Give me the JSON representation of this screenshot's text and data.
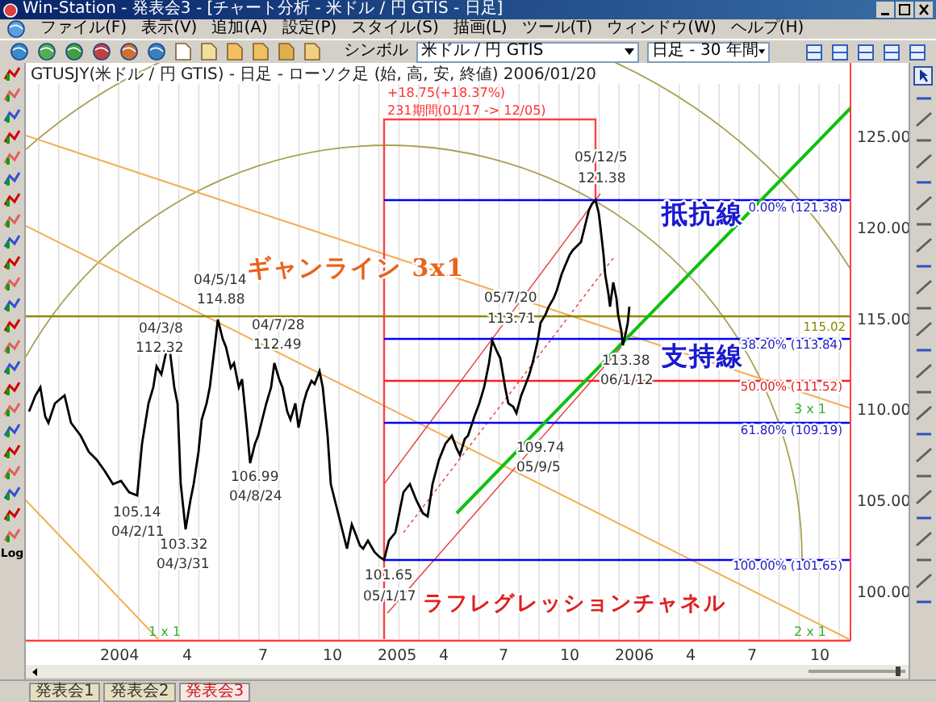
{
  "window": {
    "title": "Win-Station - 発表会3 - [チャート分析 - 米ドル / 円 GTIS - 日足]"
  },
  "menu": [
    "ファイル(F)",
    "表示(V)",
    "追加(A)",
    "設定(P)",
    "スタイル(S)",
    "描画(L)",
    "ツール(T)",
    "ウィンドウ(W)",
    "ヘルプ(H)"
  ],
  "toolbar": {
    "symbol_label": "シンボル",
    "symbol": "米ドル / 円 GTIS",
    "period": "日足 - 30 年間"
  },
  "left_toolbar": {
    "log_label": "Log"
  },
  "chart": {
    "header": "GTUSJY(米ドル / 円 GTIS) - 日足 - ローソク足 (始, 高, 安, 終値)  2006/01/20",
    "range_info": [
      "+18.75(+18.37%)",
      "231期間(01/17 -> 12/05)"
    ],
    "y_labels": [
      "125.00",
      "120.00",
      "115.00",
      "110.00",
      "105.00",
      "100.00"
    ],
    "x_labels": [
      "2004",
      "4",
      "7",
      "10",
      "2005",
      "4",
      "7",
      "10",
      "2006",
      "4",
      "7",
      "10"
    ],
    "annotations": [
      {
        "date": "04/5/14",
        "price": "114.88"
      },
      {
        "date": "04/3/8",
        "price": "112.32"
      },
      {
        "date": "04/7/28",
        "price": "112.49"
      },
      {
        "price": "105.14",
        "date": "04/2/11"
      },
      {
        "price": "103.32",
        "date": "04/3/31"
      },
      {
        "price": "106.99",
        "date": "04/8/24"
      },
      {
        "price": "101.65",
        "date": "05/1/17"
      },
      {
        "date": "05/7/20",
        "price": "113.71"
      },
      {
        "date": "05/12/5",
        "price": "121.38"
      },
      {
        "price": "113.38",
        "date": "06/1/12"
      },
      {
        "price": "109.74",
        "date": "05/9/5"
      }
    ],
    "fib_labels": [
      "0.00% (121.38)",
      "38.20% (113.84)",
      "50.00% (111.52)",
      "61.80% (109.19)",
      "100.00% (101.65)"
    ],
    "level_label": "115.02",
    "gann_labels": [
      "3 x 1",
      "2 x 1",
      "1 x 1"
    ],
    "titles": [
      "ギャンライン 3x1",
      "抵抗線",
      "支持線",
      "ラフレグレッションチャネル"
    ]
  },
  "zoom_slider": {
    "level": 0.95
  },
  "tabs": [
    {
      "label": "発表会1",
      "selected": false
    },
    {
      "label": "発表会2",
      "selected": false
    },
    {
      "label": "発表会3",
      "selected": true
    }
  ]
}
